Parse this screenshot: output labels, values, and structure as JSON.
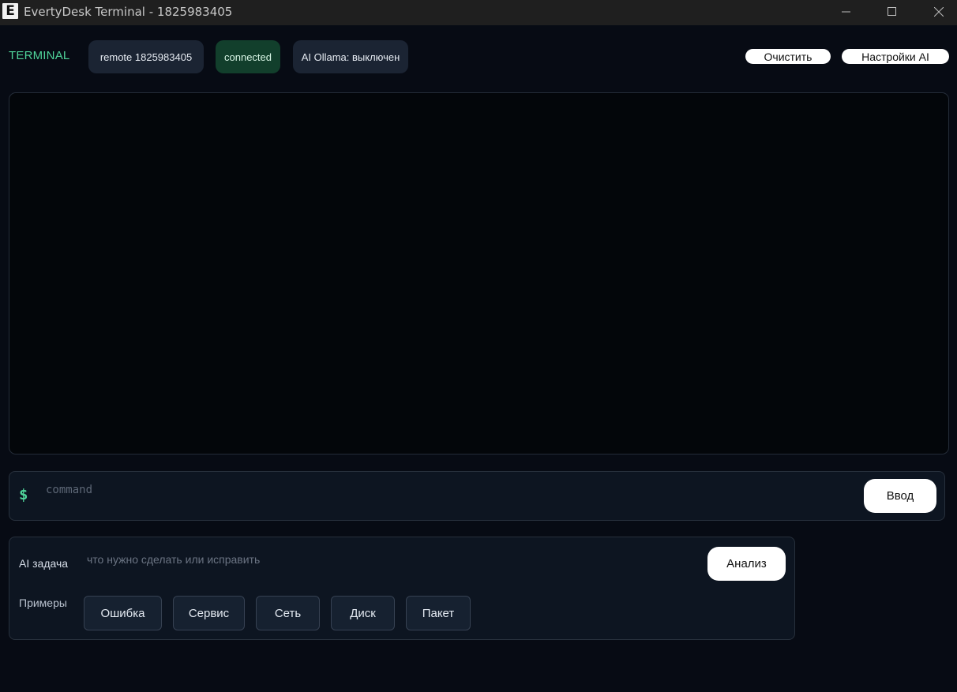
{
  "window": {
    "title": "EvertyDesk Terminal - 1825983405",
    "app_icon": "e-logo-icon",
    "app_icon_glyph": "E",
    "controls": [
      "minimize-icon",
      "maximize-icon",
      "close-icon"
    ]
  },
  "header": {
    "label": "TERMINAL",
    "remote_badge": "remote 1825983405",
    "status_badge": "connected",
    "ai_badge": "AI Ollama: выключен",
    "clear_button": "Очистить",
    "ai_settings_button": "Настройки AI"
  },
  "terminal": {
    "output": ""
  },
  "command_bar": {
    "prompt": "$",
    "placeholder": "command",
    "value": "",
    "submit_label": "Ввод"
  },
  "ai_panel": {
    "task_label": "AI задача",
    "task_placeholder": "что нужно сделать или исправить",
    "task_value": "",
    "analyze_button": "Анализ",
    "examples_label": "Примеры",
    "examples": [
      "Ошибка",
      "Сервис",
      "Сеть",
      "Диск",
      "Пакет"
    ]
  },
  "colors": {
    "background": "#070b14",
    "accent_green": "#4fd39a",
    "status_green_bg": "#123f2c",
    "badge_bg": "#1b2433",
    "panel_bg": "#0d1521",
    "terminal_bg": "#03060a",
    "titlebar_bg": "#1f1f1f"
  }
}
